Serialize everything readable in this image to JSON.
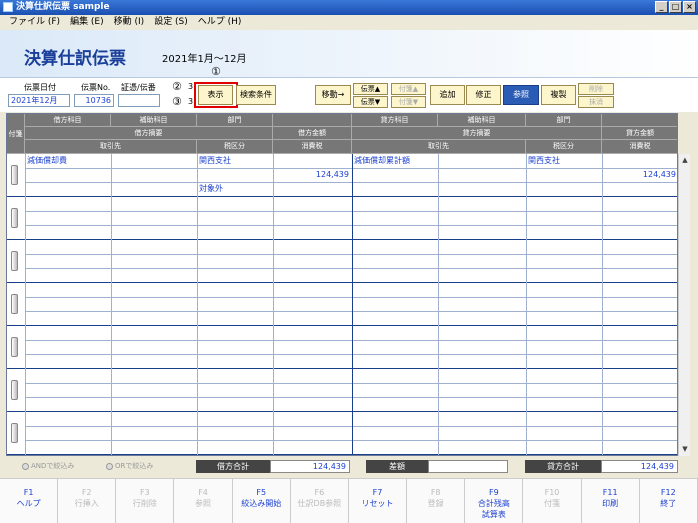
{
  "window": {
    "title": "決算仕訳伝票 sample"
  },
  "menu": [
    "ファイル (F)",
    "編集 (E)",
    "移動 (I)",
    "設定 (S)",
    "ヘルプ (H)"
  ],
  "header": {
    "title": "決算仕訳伝票",
    "period": "2021年1月～12月"
  },
  "toolbar": {
    "date_label": "伝票日付",
    "date_value": "2021年12月",
    "no_label": "伝票No.",
    "no_value": "10736",
    "cert_label": "証憑/伝番",
    "cert_value": "",
    "show_button": "表示",
    "search_button": "検索条件",
    "move_button": "移動→",
    "voucher_up": "伝票▲",
    "voucher_down": "伝票▼",
    "tag_up": "付箋▲",
    "tag_down": "付箋▼",
    "add": "追加",
    "edit": "修正",
    "ref": "参照",
    "copy": "複製",
    "delete": "削除",
    "erase": "抹消",
    "marker1": "①",
    "marker2": "②",
    "marker3": "③",
    "marker_s1": "3",
    "marker_s2": "3"
  },
  "grid": {
    "tag_header": "付箋",
    "h_debit": [
      "借方科目",
      "補助科目",
      "部門"
    ],
    "h_debit_desc": "借方摘要",
    "h_debit_amount": "借方金額",
    "h_debit_partner": "取引先",
    "h_debit_tax": "税区分",
    "h_debit_ctax": "消費税",
    "h_credit": [
      "貸方科目",
      "補助科目",
      "部門"
    ],
    "h_credit_desc": "貸方摘要",
    "h_credit_amount": "貸方金額",
    "h_credit_partner": "取引先",
    "h_credit_tax": "税区分",
    "h_credit_ctax": "消費税",
    "row1": {
      "debit_account": "減価償却費",
      "debit_dept": "関西支社",
      "debit_amount": "124,439",
      "debit_tax": "対象外",
      "credit_account": "減価償却累計額",
      "credit_dept": "関西支社",
      "credit_amount": "124,439"
    }
  },
  "footer": {
    "and_filter": "ANDで絞込み",
    "or_filter": "ORで絞込み",
    "debit_total_label": "借方合計",
    "debit_total": "124,439",
    "diff_label": "差額",
    "diff_value": "",
    "credit_total_label": "貸方合計",
    "credit_total": "124,439"
  },
  "fkeys": [
    {
      "key": "F1",
      "label": "ヘルプ",
      "enabled": true
    },
    {
      "key": "F2",
      "label": "行挿入",
      "enabled": false
    },
    {
      "key": "F3",
      "label": "行削除",
      "enabled": false
    },
    {
      "key": "F4",
      "label": "参照",
      "enabled": false
    },
    {
      "key": "F5",
      "label": "絞込み開始",
      "enabled": true
    },
    {
      "key": "F6",
      "label": "仕訳DB参照",
      "enabled": false
    },
    {
      "key": "F7",
      "label": "リセット",
      "enabled": true
    },
    {
      "key": "F8",
      "label": "登録",
      "enabled": false
    },
    {
      "key": "F9",
      "label": "合計残高\n試算表",
      "enabled": true
    },
    {
      "key": "F10",
      "label": "付箋",
      "enabled": false
    },
    {
      "key": "F11",
      "label": "印刷",
      "enabled": true
    },
    {
      "key": "F12",
      "label": "終了",
      "enabled": true
    }
  ]
}
